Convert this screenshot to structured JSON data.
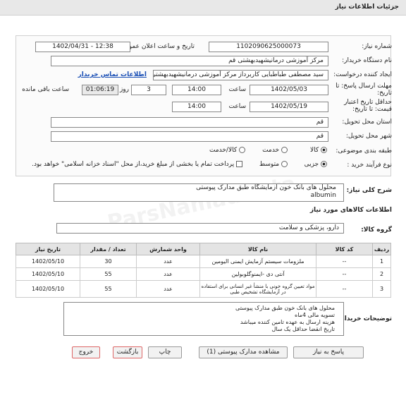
{
  "header": {
    "title": "جزئیات اطلاعات نیاز"
  },
  "fields": {
    "need_number_label": "شماره نیاز:",
    "need_number": "1102090625000073",
    "announce_label": "تاریخ و ساعت اعلان عمومی:",
    "announce_value": "1402/04/31 - 12:38",
    "buyer_label": "نام دستگاه خریدار:",
    "buyer_value": "مرکز آموزشی درمانیشهیدبهشتی قم",
    "creator_label": "ایجاد کننده درخواست:",
    "creator_value": "سید مصطفی  طباطبایی  کاربرداز  مرکز آموزشی درمانیشهیدبهشتی قم",
    "contact_link": "اطلاعات تماس خریدار",
    "deadline_label": "مهلت ارسال پاسخ: تا تاریخ:",
    "deadline_date": "1402/05/03",
    "time_label": "ساعت",
    "deadline_time": "14:00",
    "days_value": "3",
    "days_label": "روز و",
    "remaining_value": "01:06:19",
    "remaining_label": "ساعت باقی مانده",
    "validity_label": "حداقل تاریخ اعتبار قیمت: تا تاریخ:",
    "validity_date": "1402/05/19",
    "validity_time": "14:00",
    "province_label": "استان محل تحویل:",
    "province_value": "قم",
    "city_label": "شهر محل تحویل:",
    "city_value": "قم",
    "category_label": "طبقه بندی موضوعی:",
    "category_goods": "کالا",
    "category_service": "خدمت",
    "category_both": "کالا/خدمت",
    "process_label": "نوع فرآیند خرید :",
    "process_partial": "جزیی",
    "process_medium": "متوسط",
    "process_note": "پرداخت تمام یا بخشی از مبلغ خرید،از محل \"اسناد خزانه اسلامی\" خواهد بود."
  },
  "summary": {
    "label": "شرح کلی نیاز:",
    "line1": "محلول های بانک خون آزمایشگاه طبق مدارک پیوستی",
    "line2": "albumin"
  },
  "goods_section_title": "اطلاعات کالاهای مورد نیاز",
  "group": {
    "label": "گروه کالا:",
    "value": "دارو، پزشکی و سلامت"
  },
  "table": {
    "headers": [
      "ردیف",
      "کد کالا",
      "نام کالا",
      "واحد شمارش",
      "تعداد / مقدار",
      "تاریخ نیاز"
    ],
    "rows": [
      {
        "row": "1",
        "code": "--",
        "name": "ملزومات سیستم آزمایش ایمنی الیومین",
        "unit": "عدد",
        "qty": "30",
        "date": "1402/05/10"
      },
      {
        "row": "2",
        "code": "--",
        "name": "آنتی دی -ایمنوگلوبولین",
        "unit": "عدد",
        "qty": "55",
        "date": "1402/05/10"
      },
      {
        "row": "3",
        "code": "--",
        "name": "مواد تعیین گروه خونی با منشأ غیر انسانی برای استفاده در آزمایشگاه تشخیص طبی",
        "unit": "عدد",
        "qty": "55",
        "date": "1402/05/10"
      }
    ]
  },
  "buyer_notes": {
    "label": "توضیحات خریدار:",
    "lines": [
      "محلول های بانک خون طبق مدارک پیوستی",
      "تسویه مالی 4ماه",
      "هزینه ارسال به عهده تامین کننده میباشد",
      "تاریخ انقضا حداقل یک سال"
    ]
  },
  "buttons": {
    "reply": "پاسخ به نیاز",
    "attachments": "مشاهده مدارک پیوستی (1)",
    "print": "چاپ",
    "back": "بازگشت",
    "exit": "خروج"
  },
  "watermark": "ParsNamadData"
}
